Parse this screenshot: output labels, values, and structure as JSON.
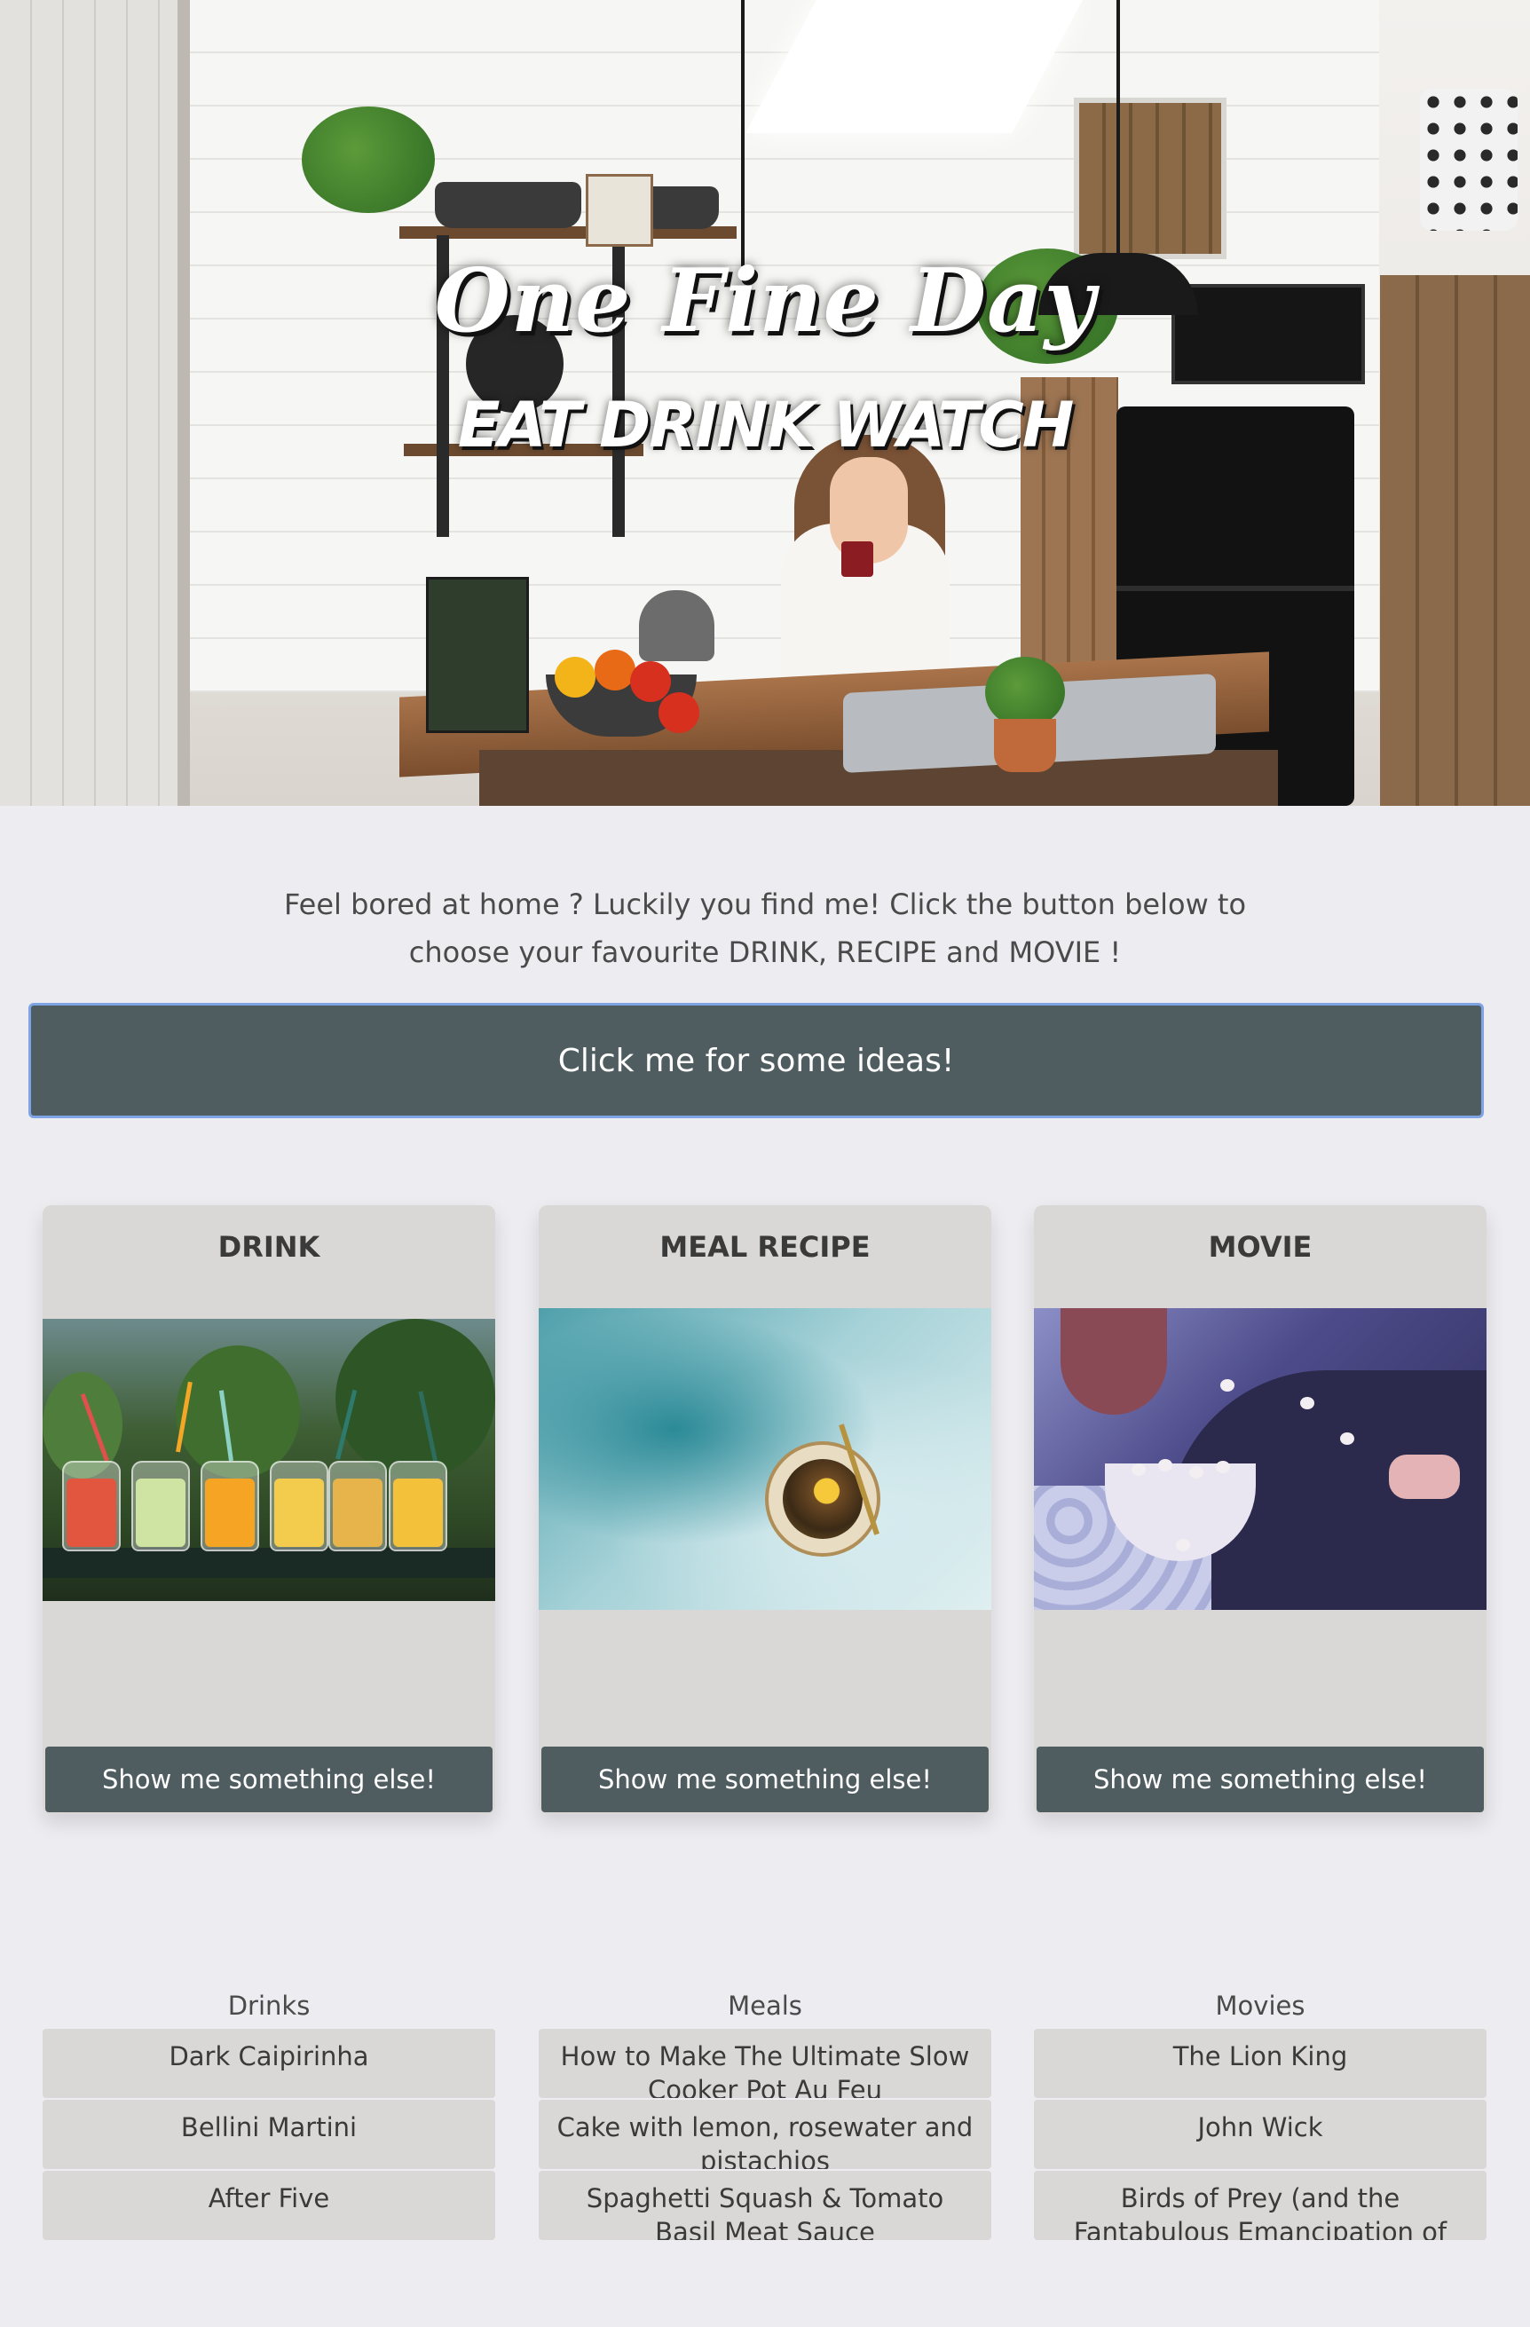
{
  "hero": {
    "title": "One Fine Day",
    "subtitle": "EAT DRINK WATCH"
  },
  "intro": {
    "text": "Feel bored at home ? Luckily you find me! Click the button below to choose your favourite DRINK, RECIPE and MOVIE !"
  },
  "cta": {
    "label": "Click me for some ideas!",
    "color": "#4f5d61",
    "focus_ring": "#7fa4e6"
  },
  "cards": [
    {
      "title": "DRINK",
      "image": "drink-jars-image",
      "button": "Show me something else!"
    },
    {
      "title": "MEAL RECIPE",
      "image": "meal-plate-image",
      "button": "Show me something else!"
    },
    {
      "title": "MOVIE",
      "image": "movie-popcorn-image",
      "button": "Show me something else!"
    }
  ],
  "lists": [
    {
      "heading": "Drinks",
      "items": [
        "Dark Caipirinha",
        "Bellini Martini",
        "After Five"
      ]
    },
    {
      "heading": "Meals",
      "items": [
        "How to Make The Ultimate Slow Cooker Pot Au Feu",
        "Cake with lemon, rosewater and pistachios",
        "Spaghetti Squash & Tomato Basil Meat Sauce"
      ]
    },
    {
      "heading": "Movies",
      "items": [
        "The Lion King",
        "John Wick",
        "Birds of Prey (and the Fantabulous Emancipation of One Harley Quinn)"
      ]
    }
  ],
  "colors": {
    "page_background": "#ededf1",
    "card_background": "#d9d8d6",
    "button": "#4f5d61"
  }
}
